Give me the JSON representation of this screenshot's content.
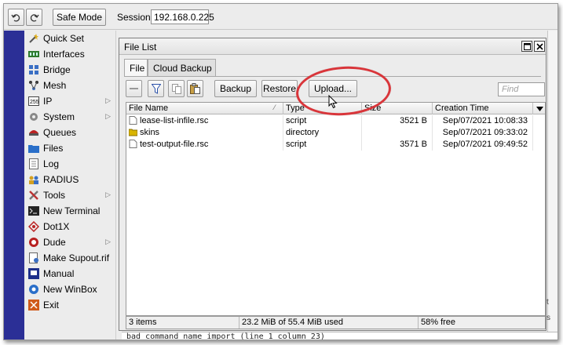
{
  "toolbar": {
    "undo_icon": "undo-icon",
    "redo_icon": "redo-icon",
    "safe_mode_label": "Safe Mode",
    "session_label": "Session:",
    "session_value": "192.168.0.225"
  },
  "sidebar": {
    "items": [
      {
        "label": "Quick Set",
        "icon": "wand-icon"
      },
      {
        "label": "Interfaces",
        "icon": "interfaces-icon"
      },
      {
        "label": "Bridge",
        "icon": "bridge-icon"
      },
      {
        "label": "Mesh",
        "icon": "mesh-icon"
      },
      {
        "label": "IP",
        "icon": "ip-icon",
        "submenu": true
      },
      {
        "label": "System",
        "icon": "gear-icon",
        "submenu": true
      },
      {
        "label": "Queues",
        "icon": "queues-icon"
      },
      {
        "label": "Files",
        "icon": "folder-icon"
      },
      {
        "label": "Log",
        "icon": "log-icon"
      },
      {
        "label": "RADIUS",
        "icon": "users-icon"
      },
      {
        "label": "Tools",
        "icon": "tools-icon",
        "submenu": true
      },
      {
        "label": "New Terminal",
        "icon": "terminal-icon"
      },
      {
        "label": "Dot1X",
        "icon": "dot1x-icon"
      },
      {
        "label": "Dude",
        "icon": "dude-icon",
        "submenu": true
      },
      {
        "label": "Make Supout.rif",
        "icon": "supout-icon"
      },
      {
        "label": "Manual",
        "icon": "manual-icon"
      },
      {
        "label": "New WinBox",
        "icon": "winbox-icon"
      },
      {
        "label": "Exit",
        "icon": "exit-icon"
      }
    ]
  },
  "window": {
    "title": "File List",
    "tabs": [
      {
        "label": "File",
        "active": true
      },
      {
        "label": "Cloud Backup",
        "active": false
      }
    ],
    "buttons": {
      "backup": "Backup",
      "restore": "Restore",
      "upload": "Upload..."
    },
    "find_placeholder": "Find",
    "columns": {
      "name": "File Name",
      "type": "Type",
      "size": "Size",
      "time": "Creation Time"
    },
    "rows": [
      {
        "name": "lease-list-infile.rsc",
        "type": "script",
        "size": "3521 B",
        "time": "Sep/07/2021 10:08:33",
        "icon": "file-icon"
      },
      {
        "name": "skins",
        "type": "directory",
        "size": "",
        "time": "Sep/07/2021 09:33:02",
        "icon": "folder-icon"
      },
      {
        "name": "test-output-file.rsc",
        "type": "script",
        "size": "3571 B",
        "time": "Sep/07/2021 09:49:52",
        "icon": "file-icon"
      }
    ],
    "status": {
      "items": "3 items",
      "usage": "23.2 MiB of 55.4 MiB used",
      "free": "58% free"
    }
  },
  "console_text": "bad command name import (line 1 column 23)",
  "colors": {
    "strip": "#2b2f96",
    "highlight": "#d9353a"
  }
}
